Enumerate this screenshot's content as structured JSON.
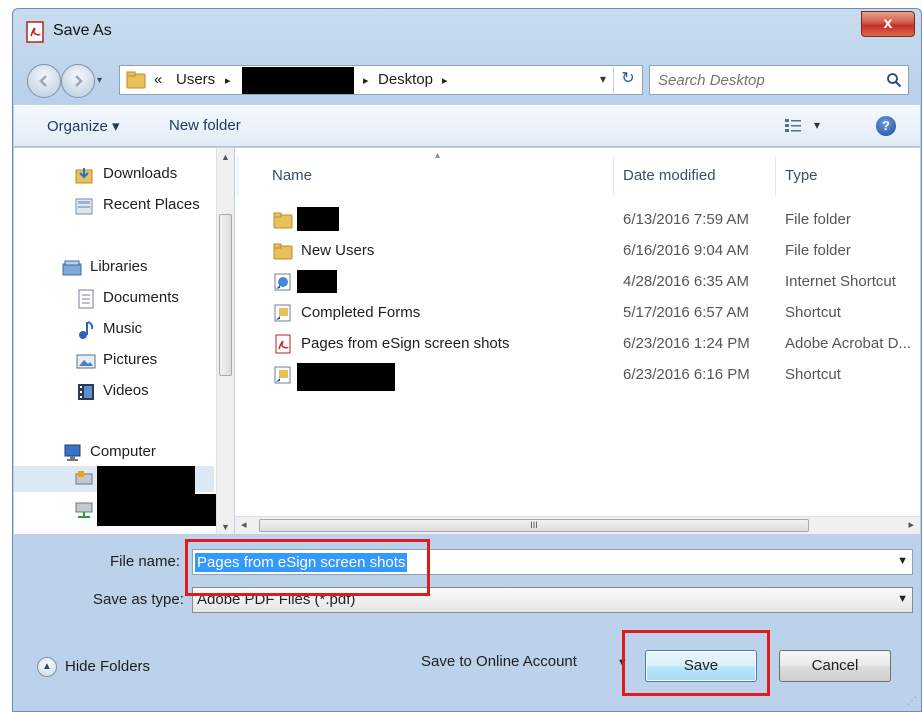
{
  "caption": "",
  "window": {
    "title": "Save As",
    "close_glyph": "x"
  },
  "address": {
    "crumb_prefix": "«",
    "crumbs": [
      "Users",
      "Desktop"
    ],
    "separator": "▸",
    "dropdown_glyph": "▾",
    "refresh_glyph": "↻"
  },
  "search": {
    "placeholder": "Search Desktop"
  },
  "toolbar": {
    "organize": "Organize ▾",
    "new_folder": "New folder",
    "views_glyph": "▾",
    "help": "?"
  },
  "nav_pane": {
    "items": [
      {
        "label": "Downloads",
        "icon": "downloads-icon"
      },
      {
        "label": "Recent Places",
        "icon": "recent-places-icon"
      },
      {
        "label": "Libraries",
        "icon": "libraries-icon"
      },
      {
        "label": "Documents",
        "icon": "documents-icon"
      },
      {
        "label": "Music",
        "icon": "music-icon"
      },
      {
        "label": "Pictures",
        "icon": "pictures-icon"
      },
      {
        "label": "Videos",
        "icon": "videos-icon"
      },
      {
        "label": "Computer",
        "icon": "computer-icon"
      }
    ]
  },
  "file_list": {
    "columns": {
      "name": "Name",
      "date": "Date modified",
      "type": "Type"
    },
    "rows": [
      {
        "name": "",
        "redacted": true,
        "date": "6/13/2016 7:59 AM",
        "type": "File folder",
        "icon": "folder-icon"
      },
      {
        "name": "New Users",
        "redacted": false,
        "date": "6/16/2016 9:04 AM",
        "type": "File folder",
        "icon": "folder-icon"
      },
      {
        "name": "",
        "redacted": true,
        "date": "4/28/2016 6:35 AM",
        "type": "Internet Shortcut",
        "icon": "internet-shortcut-icon"
      },
      {
        "name": "Completed Forms",
        "redacted": false,
        "date": "5/17/2016 6:57 AM",
        "type": "Shortcut",
        "icon": "shortcut-icon"
      },
      {
        "name": "Pages from eSign screen shots",
        "redacted": false,
        "date": "6/23/2016 1:24 PM",
        "type": "Adobe Acrobat D...",
        "icon": "pdf-icon"
      },
      {
        "name": "",
        "redacted": true,
        "date": "6/23/2016 6:16 PM",
        "type": "Shortcut",
        "icon": "shortcut-icon"
      }
    ],
    "hscroll_grip": "III"
  },
  "form": {
    "file_name_label": "File name:",
    "file_name_value": "Pages from eSign screen shots",
    "save_type_label": "Save as type:",
    "save_type_value": "Adobe PDF Files (*.pdf)"
  },
  "footer": {
    "hide_folders": "Hide Folders",
    "save_online": "Save to Online Account",
    "save": "Save",
    "cancel": "Cancel"
  },
  "colors": {
    "highlight": "#e01b1b",
    "selection": "#3399ff",
    "frame": "#b9d1ea"
  }
}
